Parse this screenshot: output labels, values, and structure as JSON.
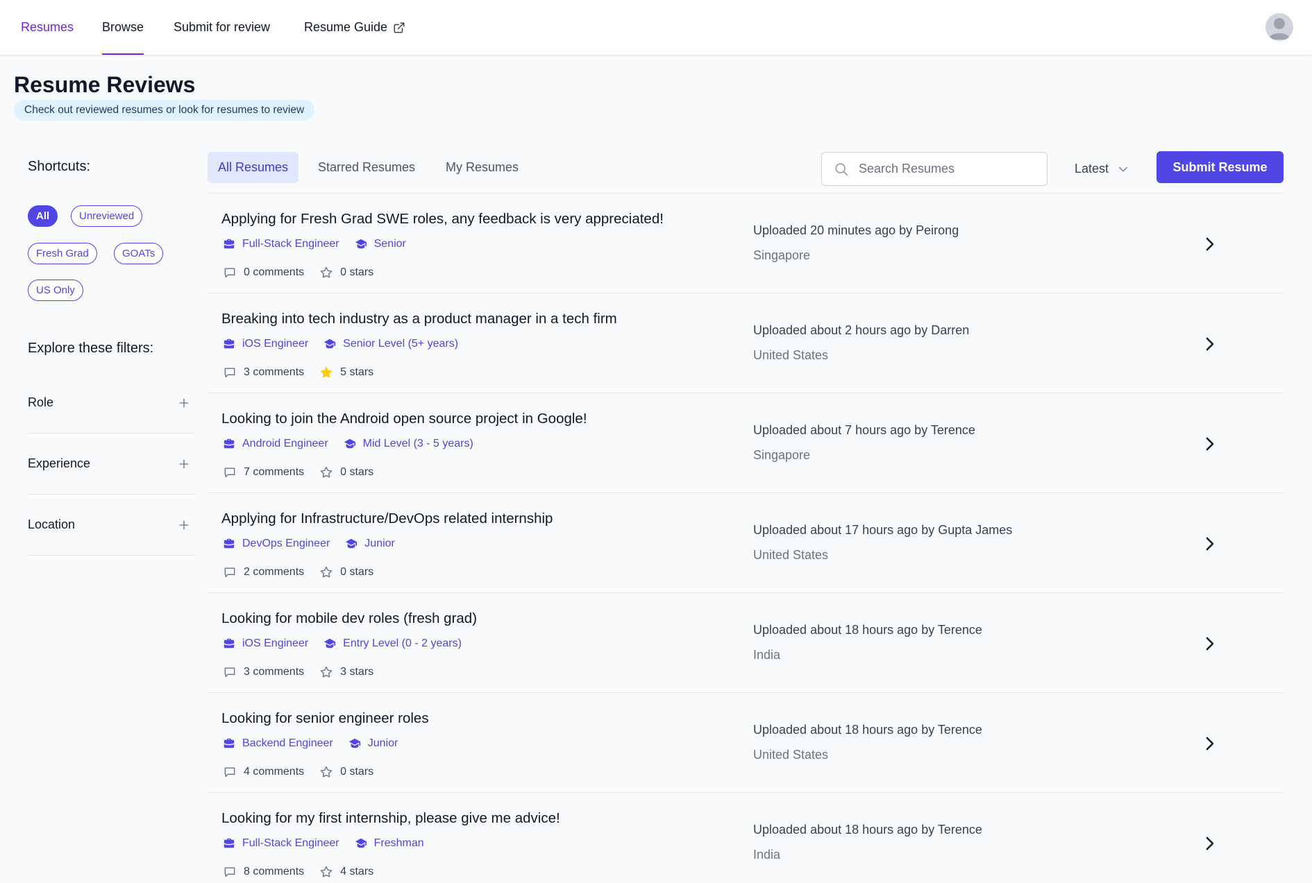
{
  "nav": {
    "items": [
      {
        "label": "Resumes"
      },
      {
        "label": "Browse"
      },
      {
        "label": "Submit for review"
      },
      {
        "label": "Resume Guide"
      }
    ]
  },
  "header": {
    "title": "Resume Reviews",
    "subtitle": "Check out reviewed resumes or look for resumes to review"
  },
  "sidebar": {
    "shortcuts_title": "Shortcuts:",
    "shortcuts": [
      "All",
      "Unreviewed",
      "Fresh Grad",
      "GOATs",
      "US Only"
    ],
    "explore_title": "Explore these filters:",
    "filters": [
      "Role",
      "Experience",
      "Location"
    ]
  },
  "tabs": [
    "All Resumes",
    "Starred Resumes",
    "My Resumes"
  ],
  "search": {
    "placeholder": "Search Resumes",
    "value": ""
  },
  "sort": {
    "selected": "Latest"
  },
  "submit_label": "Submit Resume",
  "colors": {
    "accent": "#4f46e5",
    "nav_active": "#6d28d9",
    "star_filled": "#facc15"
  },
  "resumes": [
    {
      "title": "Applying for Fresh Grad SWE roles, any feedback is very appreciated!",
      "role": "Full-Stack Engineer",
      "experience": "Senior",
      "comments": "0 comments",
      "stars": "0 stars",
      "starred": false,
      "uploaded": "Uploaded 20 minutes ago by Peirong",
      "location": "Singapore"
    },
    {
      "title": "Breaking into tech industry as a product manager in a tech firm",
      "role": "iOS Engineer",
      "experience": "Senior Level (5+ years)",
      "comments": "3 comments",
      "stars": "5 stars",
      "starred": true,
      "uploaded": "Uploaded about 2 hours ago by Darren",
      "location": "United States"
    },
    {
      "title": "Looking to join the Android open source project in Google!",
      "role": "Android Engineer",
      "experience": "Mid Level (3 - 5 years)",
      "comments": "7 comments",
      "stars": "0 stars",
      "starred": false,
      "uploaded": "Uploaded about 7 hours ago by Terence",
      "location": "Singapore"
    },
    {
      "title": "Applying for Infrastructure/DevOps related internship",
      "role": "DevOps Engineer",
      "experience": "Junior",
      "comments": "2 comments",
      "stars": "0 stars",
      "starred": false,
      "uploaded": "Uploaded about 17 hours ago by Gupta James",
      "location": "United States"
    },
    {
      "title": "Looking for mobile dev roles (fresh grad)",
      "role": "iOS Engineer",
      "experience": "Entry Level (0 - 2 years)",
      "comments": "3 comments",
      "stars": "3 stars",
      "starred": false,
      "uploaded": "Uploaded about 18 hours ago by Terence",
      "location": "India"
    },
    {
      "title": "Looking for senior engineer roles",
      "role": "Backend Engineer",
      "experience": "Junior",
      "comments": "4 comments",
      "stars": "0 stars",
      "starred": false,
      "uploaded": "Uploaded about 18 hours ago by Terence",
      "location": "United States"
    },
    {
      "title": "Looking for my first internship, please give me advice!",
      "role": "Full-Stack Engineer",
      "experience": "Freshman",
      "comments": "8 comments",
      "stars": "4 stars",
      "starred": false,
      "uploaded": "Uploaded about 18 hours ago by Terence",
      "location": "India"
    }
  ]
}
